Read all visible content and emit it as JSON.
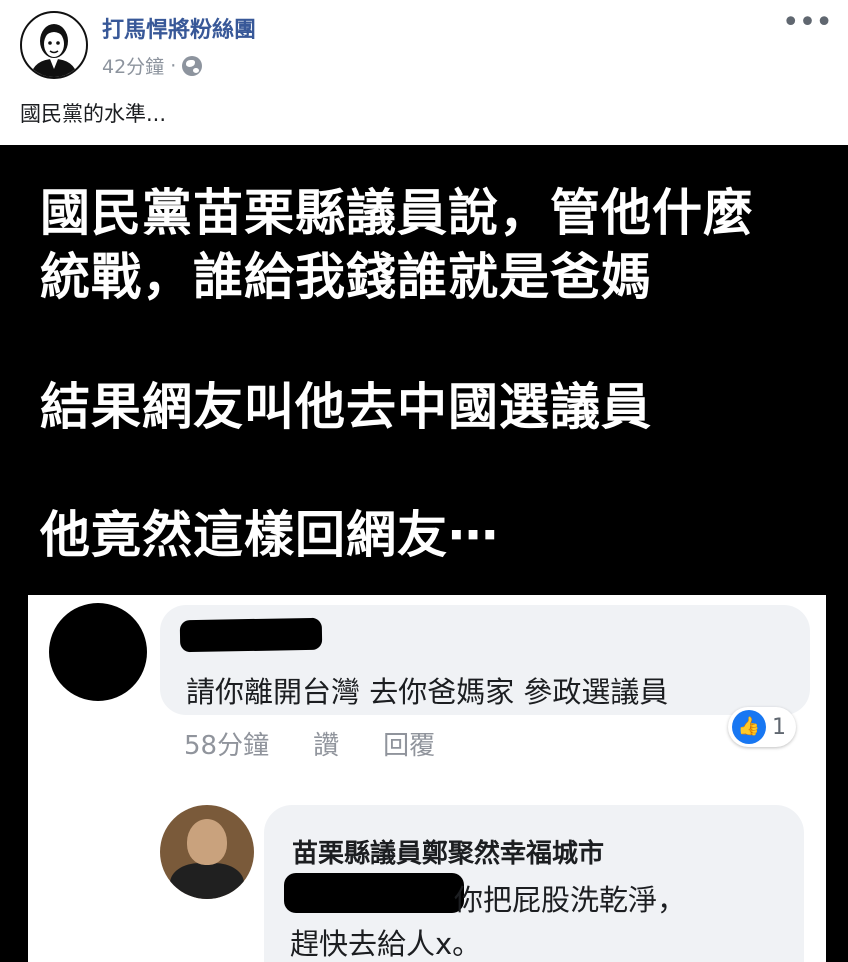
{
  "post": {
    "page_name": "打馬悍將粉絲團",
    "time": "42分鐘",
    "separator": "·",
    "text": "國民黨的水準...",
    "more_label": "•••"
  },
  "meme": {
    "lines": [
      "國民黨苗栗縣議員說，管他什麼",
      "統戰，誰給我錢誰就是爸媽",
      "結果網友叫他去中國選議員",
      "他竟然這樣回網友⋯"
    ]
  },
  "comments": {
    "first": {
      "text": "請你離開台灣 去你爸媽家 參政選議員",
      "time": "58分鐘",
      "like_label": "讚",
      "reply_label": "回覆",
      "reaction_count": "1"
    },
    "reply": {
      "author": "苗栗縣議員鄭聚然幸福城市",
      "line1": "你把屁股洗乾淨，",
      "line2": "趕快去給人x。"
    }
  },
  "colors": {
    "page_name": "#385898",
    "meta": "#8d949e",
    "bubble": "#f0f2f5",
    "like_blue": "#1877f2"
  },
  "icons": [
    "page-avatar",
    "globe-icon",
    "more-options-icon",
    "like-reaction-icon"
  ]
}
